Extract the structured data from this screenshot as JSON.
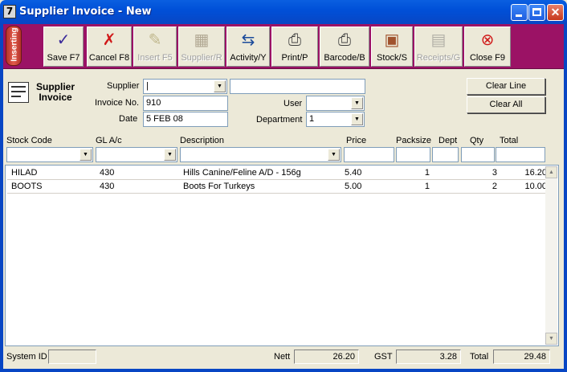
{
  "window": {
    "title": "Supplier Invoice - New",
    "app_icon_char": "7"
  },
  "mode_badge": "Inserting",
  "toolbar": [
    {
      "label": "Save F7",
      "icon": "pen-check-icon",
      "glyph": "✓",
      "color": "#3a2a9a",
      "enabled": true
    },
    {
      "label": "Cancel F8",
      "icon": "red-x-icon",
      "glyph": "✗",
      "color": "#d01818",
      "enabled": true
    },
    {
      "label": "Insert F5",
      "icon": "insert-pen-icon",
      "glyph": "✎",
      "color": "#8a7a30",
      "enabled": false
    },
    {
      "label": "Supplier/R",
      "icon": "supplier-icon",
      "glyph": "▦",
      "color": "#6a5a40",
      "enabled": false
    },
    {
      "label": "Activity/Y",
      "icon": "activity-icon",
      "glyph": "⇆",
      "color": "#1a4a9a",
      "enabled": true
    },
    {
      "label": "Print/P",
      "icon": "printer-icon",
      "glyph": "⎙",
      "color": "#404040",
      "enabled": true
    },
    {
      "label": "Barcode/B",
      "icon": "barcode-printer-icon",
      "glyph": "⎙",
      "color": "#404040",
      "enabled": true
    },
    {
      "label": "Stock/S",
      "icon": "stock-box-icon",
      "glyph": "▣",
      "color": "#a0522d",
      "enabled": true
    },
    {
      "label": "Receipts/G",
      "icon": "receipts-icon",
      "glyph": "▤",
      "color": "#6a6a6a",
      "enabled": false
    },
    {
      "label": "Close F9",
      "icon": "close-circle-icon",
      "glyph": "⊗",
      "color": "#d01818",
      "enabled": true
    }
  ],
  "header": {
    "logo_text": "Supplier Invoice",
    "supplier_label": "Supplier",
    "supplier_value": "|",
    "supplier_name_value": "",
    "invoice_no_label": "Invoice No.",
    "invoice_no_value": "910",
    "date_label": "Date",
    "date_value": "5 FEB 08",
    "user_label": "User",
    "user_value": "",
    "department_label": "Department",
    "department_value": "1",
    "clear_line_label": "Clear Line",
    "clear_all_label": "Clear All"
  },
  "columns": [
    "Stock Code",
    "GL A/c",
    "Description",
    "Price",
    "Packsize",
    "Dept",
    "Qty",
    "Total"
  ],
  "rows": [
    {
      "stock_code": "HILAD",
      "gl": "430",
      "description": "Hills Canine/Feline A/D - 156g",
      "price": "5.40",
      "packsize": "1",
      "dept": "",
      "qty": "3",
      "total": "16.20"
    },
    {
      "stock_code": "BOOTS",
      "gl": "430",
      "description": "Boots For Turkeys",
      "price": "5.00",
      "packsize": "1",
      "dept": "",
      "qty": "2",
      "total": "10.00"
    }
  ],
  "footer": {
    "system_id_label": "System ID",
    "system_id_value": "",
    "nett_label": "Nett",
    "nett_value": "26.20",
    "gst_label": "GST",
    "gst_value": "3.28",
    "total_label": "Total",
    "total_value": "29.48"
  }
}
